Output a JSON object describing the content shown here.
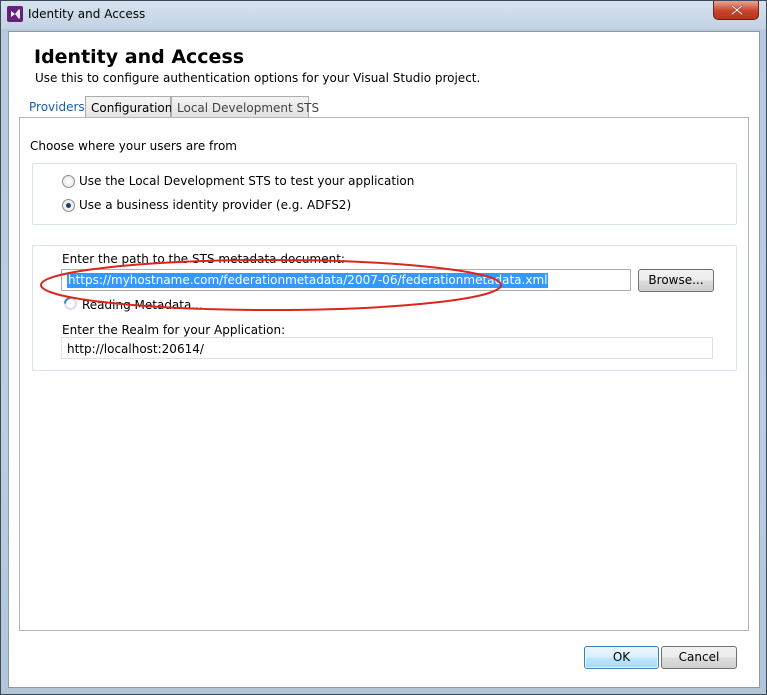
{
  "window": {
    "title": "Identity and Access",
    "icon": "visual-studio-icon",
    "close_icon": "close-icon"
  },
  "header": {
    "title": "Identity and Access",
    "subtitle": "Use this to configure authentication options for your Visual Studio project."
  },
  "tabs": [
    {
      "label": "Providers",
      "selected": true
    },
    {
      "label": "Configuration",
      "selected": false
    },
    {
      "label": "Local Development STS",
      "selected": false
    }
  ],
  "providers": {
    "choose_label": "Choose where your users are from",
    "options": [
      {
        "label": "Use the Local Development STS to test your application",
        "checked": false
      },
      {
        "label": "Use a business identity provider (e.g. ADFS2)",
        "checked": true
      }
    ],
    "sts_path_label": "Enter the path to the STS metadata document:",
    "sts_path_value": "https://myhostname.com/federationmetadata/2007-06/federationmetadata.xml",
    "browse_label": "Browse...",
    "status_text": "Reading Metadata...",
    "realm_label": "Enter the Realm for your Application:",
    "realm_value": "http://localhost:20614/"
  },
  "footer": {
    "ok_label": "OK",
    "cancel_label": "Cancel"
  },
  "colors": {
    "highlight_ellipse": "#d9271e",
    "selection": "#3399ff",
    "selected_tab_text": "#1c5dad"
  }
}
